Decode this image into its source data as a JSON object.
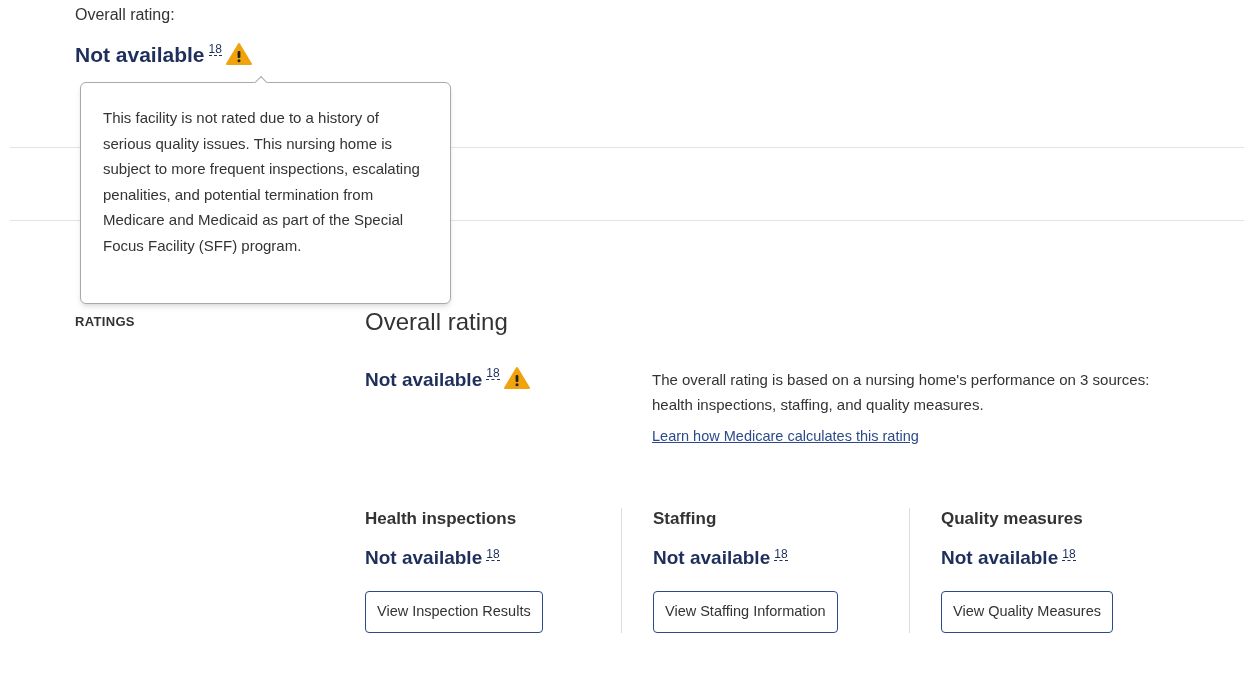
{
  "summary": {
    "label": "Overall rating:",
    "value": "Not available",
    "footnote": "18",
    "warning": true
  },
  "tooltip": {
    "text": "This facility is not rated due to a history of serious quality issues. This nursing home is subject to more frequent inspections, escalating penalities, and potential termination from Medicare and Medicaid as part of the Special Focus Facility (SFF) program."
  },
  "section_label": "RATINGS",
  "overall": {
    "heading": "Overall rating",
    "value": "Not available",
    "footnote": "18",
    "warning": true,
    "description": "The overall rating is based on a nursing home's performance on 3 sources: health inspections, staffing, and quality measures.",
    "link": "Learn how Medicare calculates this rating"
  },
  "categories": [
    {
      "heading": "Health inspections",
      "value": "Not available",
      "footnote": "18",
      "warning": false,
      "button": "View Inspection Results"
    },
    {
      "heading": "Staffing",
      "value": "Not available",
      "footnote": "18",
      "warning": false,
      "button": "View Staffing Information"
    },
    {
      "heading": "Quality measures",
      "value": "Not available",
      "footnote": "18",
      "warning": false,
      "button": "View Quality Measures"
    }
  ]
}
